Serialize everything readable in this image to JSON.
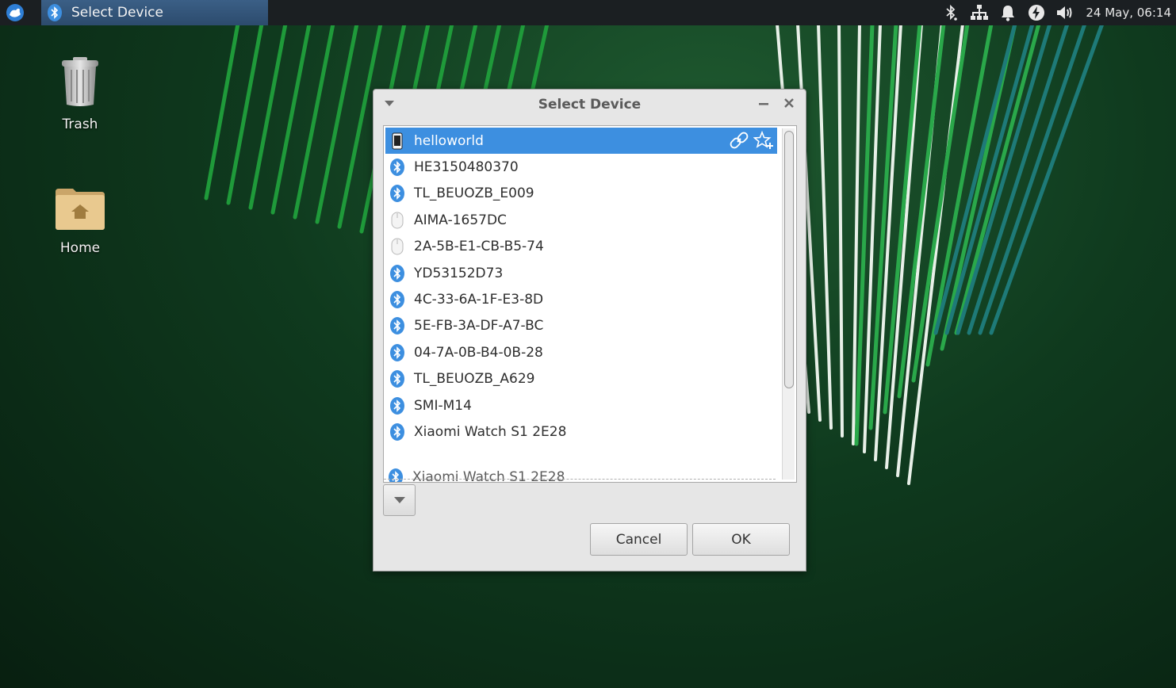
{
  "colors": {
    "panel_bg": "#1b1f22",
    "task_button": "#3b5f86",
    "selection": "#3d8fe0",
    "bluetooth_icon": "#3d8fe0"
  },
  "panel": {
    "menu_icon": "xfce-mouse-icon",
    "task": {
      "icon": "bluetooth-icon",
      "label": "Select Device"
    },
    "tray_icons": [
      "bluetooth-icon",
      "network-icon",
      "notification-bell-icon",
      "power-icon",
      "volume-icon"
    ],
    "clock": "24 May, 06:14"
  },
  "desktop": {
    "icons": [
      {
        "label": "Trash",
        "icon": "trash-icon"
      },
      {
        "label": "Home",
        "icon": "home-folder-icon"
      }
    ]
  },
  "dialog": {
    "title": "Select Device",
    "devices": [
      {
        "name": "helloworld",
        "icon": "phone-icon",
        "selected": true
      },
      {
        "name": "HE3150480370",
        "icon": "bluetooth-icon"
      },
      {
        "name": "TL_BEUOZB_E009",
        "icon": "bluetooth-icon"
      },
      {
        "name": "AIMA-1657DC",
        "icon": "mouse-icon"
      },
      {
        "name": "2A-5B-E1-CB-B5-74",
        "icon": "mouse-icon"
      },
      {
        "name": "YD53152D73",
        "icon": "bluetooth-icon"
      },
      {
        "name": "4C-33-6A-1F-E3-8D",
        "icon": "bluetooth-icon"
      },
      {
        "name": "5E-FB-3A-DF-A7-BC",
        "icon": "bluetooth-icon"
      },
      {
        "name": "04-7A-0B-B4-0B-28",
        "icon": "bluetooth-icon"
      },
      {
        "name": "TL_BEUOZB_A629",
        "icon": "bluetooth-icon"
      },
      {
        "name": "SMI-M14",
        "icon": "bluetooth-icon"
      },
      {
        "name": "Xiaomi Watch S1 2E28",
        "icon": "bluetooth-icon"
      }
    ],
    "ghost_row": "Xiaomi Watch S1 2E28",
    "row_actions": [
      "link-icon",
      "star-add-icon"
    ],
    "cancel_label": "Cancel",
    "ok_label": "OK"
  }
}
